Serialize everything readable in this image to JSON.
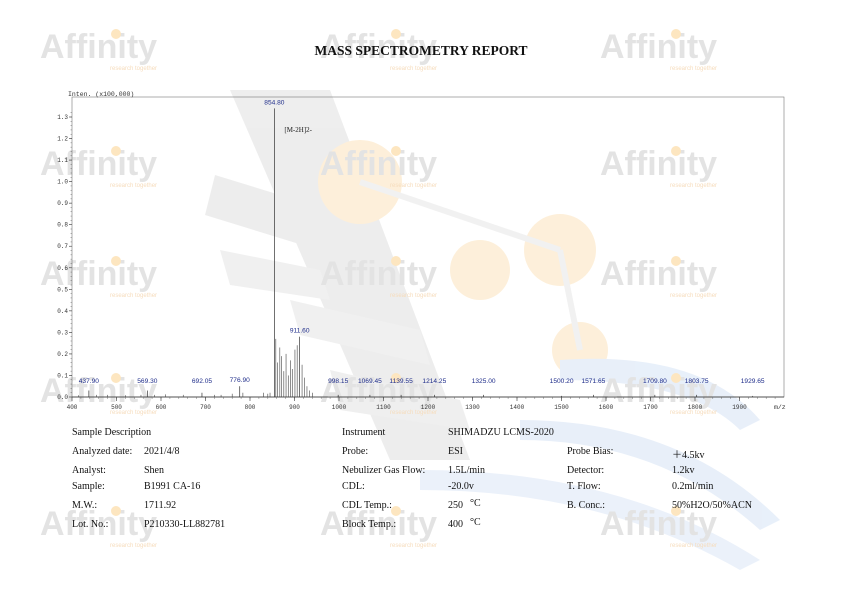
{
  "report": {
    "title": "MASS SPECTROMETRY REPORT",
    "watermark_text": "Affinity",
    "watermark_tagline": "research together"
  },
  "colors": {
    "peak_label": "#1f2d8a",
    "axis": "#333333",
    "watermark_gray": "#e6e6e6",
    "watermark_blue": "#e3ecf8",
    "watermark_orange": "#fde9c8"
  },
  "chart_data": {
    "type": "line",
    "title": "",
    "ylabel": "Inten. (x100,000)",
    "xlabel": "m/z",
    "xlim": [
      400,
      2000
    ],
    "ylim": [
      0,
      1.35
    ],
    "x_ticks": [
      "400",
      "500",
      "600",
      "700",
      "800",
      "900",
      "1000",
      "1100",
      "1200",
      "1300",
      "1400",
      "1500",
      "1600",
      "1700",
      "1800",
      "1900"
    ],
    "y_ticks": [
      "0.0",
      "0.1",
      "0.2",
      "0.3",
      "0.4",
      "0.5",
      "0.6",
      "0.7",
      "0.8",
      "0.9",
      "1.0",
      "1.1",
      "1.2",
      "1.3"
    ],
    "grid": false,
    "peaks": [
      {
        "x": 437.9,
        "y": 0.03,
        "label": "437.90"
      },
      {
        "x": 569.3,
        "y": 0.03,
        "label": "569.30"
      },
      {
        "x": 692.05,
        "y": 0.02,
        "label": "692.05"
      },
      {
        "x": 776.9,
        "y": 0.05,
        "label": "776.90"
      },
      {
        "x": 854.8,
        "y": 1.34,
        "label": "854.80"
      },
      {
        "x": 911.6,
        "y": 0.28,
        "label": "911.60"
      },
      {
        "x": 998.15,
        "y": 0.01,
        "label": "998.15"
      },
      {
        "x": 1069.45,
        "y": 0.01,
        "label": "1069.45"
      },
      {
        "x": 1139.55,
        "y": 0.01,
        "label": "1139.55"
      },
      {
        "x": 1214.25,
        "y": 0.01,
        "label": "1214.25"
      },
      {
        "x": 1325.0,
        "y": 0.01,
        "label": "1325.00"
      },
      {
        "x": 1500.2,
        "y": 0.005,
        "label": "1500.20"
      },
      {
        "x": 1571.65,
        "y": 0.01,
        "label": "1571.65"
      },
      {
        "x": 1709.8,
        "y": 0.01,
        "label": "1709.80"
      },
      {
        "x": 1803.75,
        "y": 0.01,
        "label": "1803.75"
      },
      {
        "x": 1929.65,
        "y": 0.005,
        "label": "1929.65"
      }
    ],
    "cluster_peaks": [
      [
        858,
        0.27
      ],
      [
        862,
        0.16
      ],
      [
        867,
        0.23
      ],
      [
        871,
        0.19
      ],
      [
        876,
        0.12
      ],
      [
        881,
        0.2
      ],
      [
        886,
        0.1
      ],
      [
        891,
        0.17
      ],
      [
        895,
        0.13
      ],
      [
        901,
        0.22
      ],
      [
        906,
        0.24
      ],
      [
        917,
        0.15
      ],
      [
        922,
        0.09
      ],
      [
        928,
        0.05
      ],
      [
        934,
        0.03
      ],
      [
        940,
        0.02
      ],
      [
        845,
        0.02
      ],
      [
        840,
        0.015
      ],
      [
        830,
        0.02
      ],
      [
        784,
        0.02
      ],
      [
        760,
        0.015
      ],
      [
        735,
        0.01
      ],
      [
        720,
        0.01
      ],
      [
        650,
        0.01
      ],
      [
        610,
        0.012
      ],
      [
        585,
        0.01
      ],
      [
        555,
        0.01
      ],
      [
        520,
        0.008
      ],
      [
        480,
        0.01
      ],
      [
        455,
        0.01
      ],
      [
        415,
        0.008
      ]
    ],
    "annotations": [
      {
        "x": 854.8,
        "y": 1.23,
        "text": "[M-2H]2-"
      }
    ]
  },
  "info": {
    "left": {
      "section_title": "Sample Description",
      "analyzed_label": "Analyzed date:",
      "analyzed_value": "2021/4/8",
      "analyst_label": "Analyst:",
      "analyst_value": "Shen",
      "sample_label": "Sample:",
      "sample_value": "B1991 CA-16",
      "mw_label": "M.W.:",
      "mw_value": "1711.92",
      "lot_label": "Lot. No.:",
      "lot_value": "P210330-LL882781"
    },
    "middle": {
      "section_title": "Instrument",
      "probe_label": "Probe:",
      "nebulizer_label": "Nebulizer Gas Flow:",
      "cdl_label": "CDL:",
      "cdl_temp_label": "CDL Temp.:",
      "block_temp_label": "Block Temp.:"
    },
    "values": {
      "instrument": "SHIMADZU LCMS-2020",
      "probe": "ESI",
      "nebulizer": "1.5L/min",
      "cdl": "-20.0v",
      "cdl_temp": "250",
      "block_temp": "400",
      "temp_unit": "°C"
    },
    "right": {
      "probe_bias_label": "Probe Bias:",
      "probe_bias_value": "＋4.5kv",
      "detector_label": "Detector:",
      "detector_value": "1.2kv",
      "tflow_label": "T. Flow:",
      "tflow_value": "0.2ml/min",
      "bconc_label": "B. Conc.:",
      "bconc_value": "50%H2O/50%ACN"
    }
  }
}
